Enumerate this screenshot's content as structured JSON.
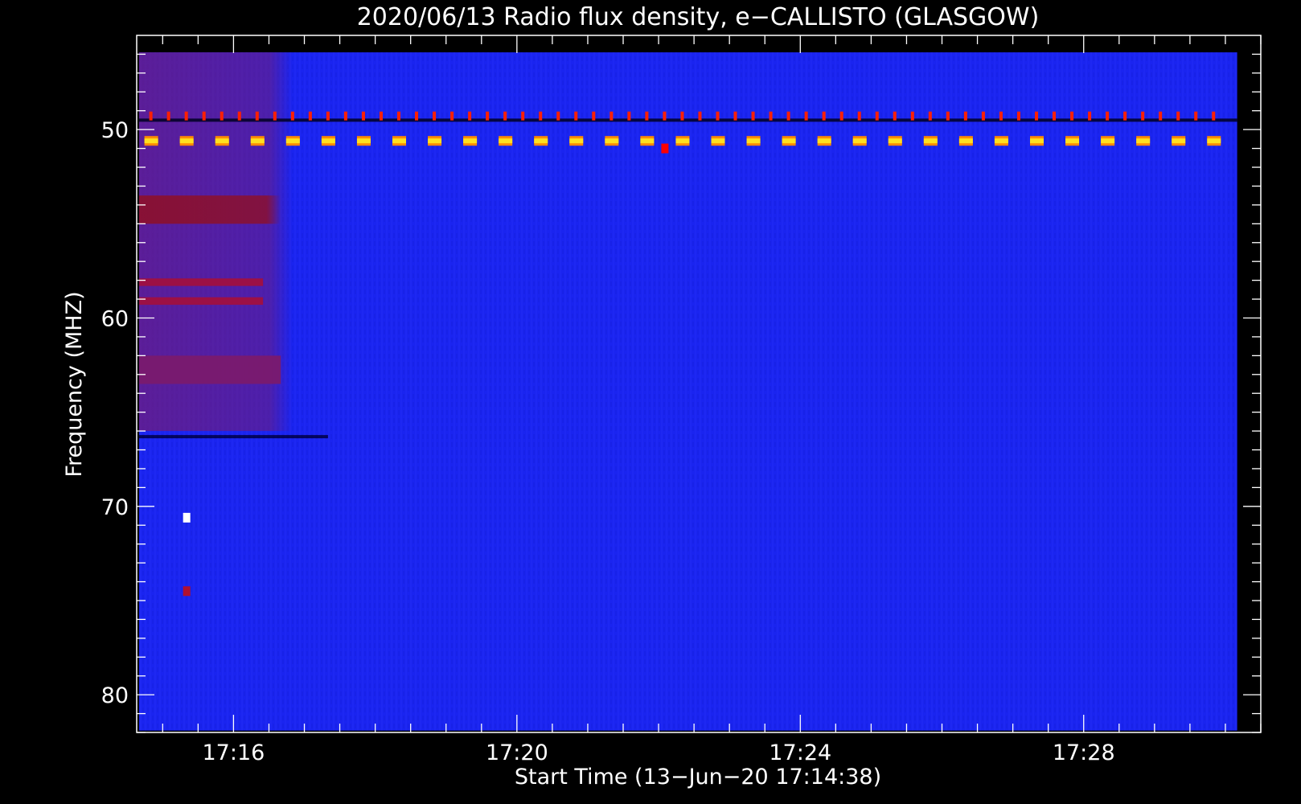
{
  "chart_data": {
    "type": "heatmap",
    "title": "2020/06/13  Radio flux density, e−CALLISTO (GLASGOW)",
    "xlabel": "Start Time (13−Jun−20 17:14:38)",
    "ylabel": "Frequency (MHZ)",
    "xlim": [
      "17:14:38",
      "17:30:30"
    ],
    "ylim": [
      45,
      82
    ],
    "y_inverted": true,
    "x_ticks": [
      "17:16",
      "17:20",
      "17:24",
      "17:28"
    ],
    "y_ticks": [
      50,
      60,
      70,
      80
    ],
    "data_extent": {
      "time": [
        "17:14:40",
        "17:30:10"
      ],
      "frequency": [
        45.9,
        81.9
      ]
    },
    "background_color": "#1a24f0",
    "features": [
      {
        "kind": "band",
        "name": "early-red-emission",
        "time": [
          "17:14:40",
          "17:16:50"
        ],
        "frequency": [
          45.9,
          66.0
        ],
        "color": "#7a1a6e"
      },
      {
        "kind": "band",
        "name": "strong-band-54",
        "time": [
          "17:14:40",
          "17:16:40"
        ],
        "frequency": [
          53.5,
          55.0
        ],
        "color": "#8a1030"
      },
      {
        "kind": "band",
        "name": "band-58",
        "time": [
          "17:14:40",
          "17:16:25"
        ],
        "frequency": [
          57.9,
          58.3
        ],
        "color": "#a01040"
      },
      {
        "kind": "band",
        "name": "band-59",
        "time": [
          "17:14:40",
          "17:16:25"
        ],
        "frequency": [
          58.9,
          59.3
        ],
        "color": "#a01040"
      },
      {
        "kind": "band",
        "name": "band-62",
        "time": [
          "17:14:40",
          "17:16:40"
        ],
        "frequency": [
          62.0,
          63.5
        ],
        "color": "#7a1a6e"
      },
      {
        "kind": "line",
        "name": "dark-line-66",
        "time": [
          "17:14:40",
          "17:17:20"
        ],
        "frequency": 66.3,
        "color": "#000044"
      },
      {
        "kind": "line",
        "name": "dark-line-49.5",
        "time": [
          "17:14:40",
          "17:30:10"
        ],
        "frequency": 49.5,
        "color": "#000022"
      },
      {
        "kind": "periodic",
        "name": "red-spikes-49.3",
        "time": [
          "17:14:40",
          "17:30:10"
        ],
        "interval_s": 15,
        "frequency": 49.3,
        "color": "#ff2000"
      },
      {
        "kind": "periodic",
        "name": "yellow-blocks-50.6",
        "time": [
          "17:14:40",
          "17:30:10"
        ],
        "interval_s": 30,
        "frequency": 50.6,
        "color": "#ffe020"
      },
      {
        "kind": "spot",
        "name": "spot-70.6",
        "time": "17:15:20",
        "frequency": 70.6,
        "color": "#ffffff"
      },
      {
        "kind": "spot",
        "name": "spot-74.5",
        "time": "17:15:20",
        "frequency": 74.5,
        "color": "#b01030"
      },
      {
        "kind": "spot",
        "name": "spot-51",
        "time": "17:22:05",
        "frequency": 51.0,
        "color": "#ff0000"
      }
    ]
  }
}
